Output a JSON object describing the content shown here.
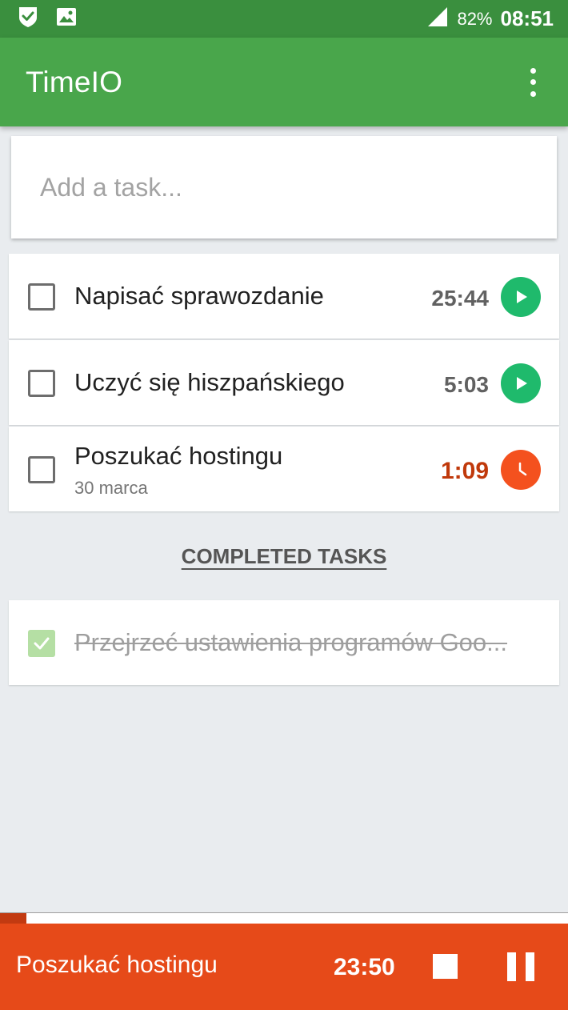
{
  "colors": {
    "status_bar": "#3a8f3e",
    "app_bar": "#49a64b",
    "play_button": "#1fba6c",
    "active_timer": "#c0390b",
    "clock_button": "#f4511e",
    "player_bar": "#e64a19",
    "completed_check": "#b5dfa4"
  },
  "status_bar": {
    "left_icons": [
      "shield-check-icon",
      "image-icon"
    ],
    "signal_icon": "signal-icon",
    "battery": "82%",
    "time": "08:51"
  },
  "app_bar": {
    "title": "TimeIO",
    "menu_icon": "more-vertical-icon"
  },
  "add_task": {
    "placeholder": "Add a task..."
  },
  "tasks": [
    {
      "title": "Napisać sprawozdanie",
      "subtitle": "",
      "timer": "25:44",
      "checked": false,
      "action_icon": "play-icon"
    },
    {
      "title": "Uczyć się hiszpańskiego",
      "subtitle": "",
      "timer": "5:03",
      "checked": false,
      "action_icon": "play-icon"
    },
    {
      "title": "Poszukać hostingu",
      "subtitle": "30 marca",
      "timer": "1:09",
      "checked": false,
      "action_icon": "clock-icon",
      "active": true
    }
  ],
  "completed": {
    "header": "COMPLETED TASKS",
    "items": [
      {
        "title": "Przejrzeć ustawienia programów Goo...",
        "checked": true
      }
    ]
  },
  "player": {
    "task": "Poszukać hostingu",
    "time": "23:50",
    "progress_fraction": 0.047,
    "stop_icon": "stop-icon",
    "pause_icon": "pause-icon"
  }
}
